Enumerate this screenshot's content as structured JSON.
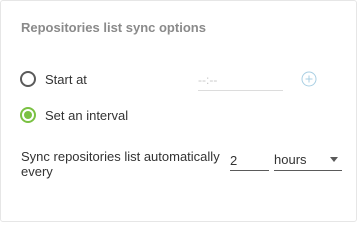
{
  "section": {
    "title": "Repositories list sync options"
  },
  "options": {
    "start_at": {
      "label": "Start at",
      "selected": false,
      "time_placeholder": "--:--"
    },
    "interval": {
      "label": "Set an interval",
      "selected": true
    }
  },
  "sync": {
    "label": "Sync repositories list automatically every",
    "interval_value": "2",
    "unit": "hours"
  },
  "colors": {
    "accent": "#7ac143",
    "title": "#8a8a8a",
    "add_icon": "#a9cfe3"
  },
  "icons": {
    "add": "plus-circle-icon",
    "dropdown": "caret-down-icon"
  }
}
